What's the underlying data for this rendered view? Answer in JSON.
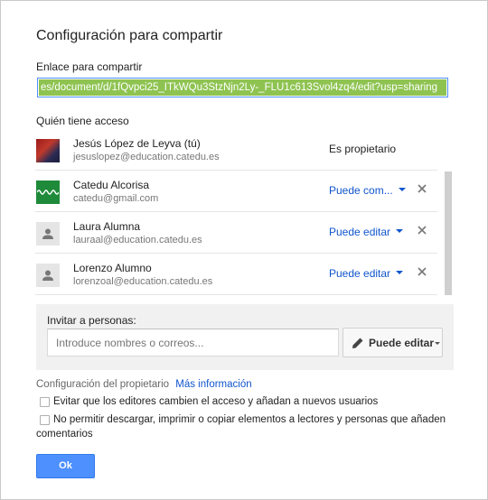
{
  "dialog": {
    "title": "Configuración para compartir",
    "link_label": "Enlace para compartir",
    "link_value": "es/document/d/1fQvpci25_ITkWQu3StzNjn2Ly-_FLU1c613Svol4zq4/edit?usp=sharing",
    "access_label": "Quién tiene acceso"
  },
  "people": [
    {
      "name": "Jesús López de Leyva (tú)",
      "email": "jesuslopez@education.catedu.es",
      "role": "Es propietario",
      "avatar": "photo-avatar"
    },
    {
      "name": "Catedu Alcorisa",
      "email": "catedu@gmail.com",
      "permission": "Puede com...",
      "avatar": "logo-avatar"
    },
    {
      "name": "Laura Alumna",
      "email": "lauraal@education.catedu.es",
      "permission": "Puede editar",
      "avatar": "person-icon"
    },
    {
      "name": "Lorenzo Alumno",
      "email": "lorenzoal@education.catedu.es",
      "permission": "Puede editar",
      "avatar": "person-icon"
    }
  ],
  "invite": {
    "label": "Invitar a personas:",
    "placeholder": "Introduce nombres o correos...",
    "button_label": "Puede editar"
  },
  "owner": {
    "settings_label": "Configuración del propietario",
    "more_info": "Más información",
    "option1": "Evitar que los editores cambien el acceso y añadan a nuevos usuarios",
    "option2_line1": "No permitir descargar, imprimir o copiar elementos a lectores y personas que añaden",
    "option2_line2": "comentarios"
  },
  "ok_label": "Ok",
  "colors": {
    "accent_blue": "#4d90fe",
    "link_blue": "#1155cc",
    "selection_green": "#8ec351"
  }
}
